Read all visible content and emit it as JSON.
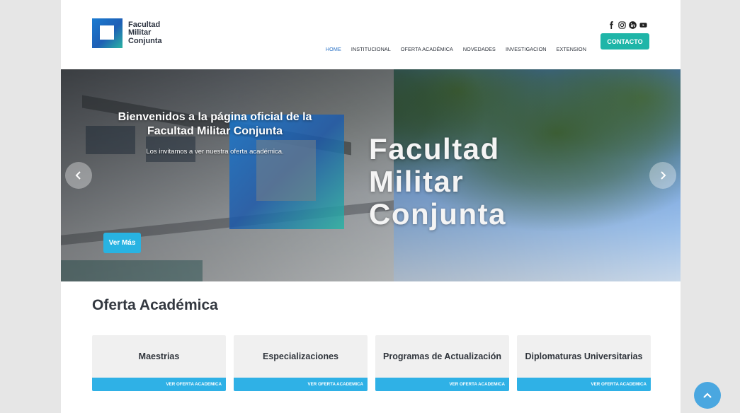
{
  "header": {
    "logo_text": [
      "Facultad",
      "Militar",
      "Conjunta"
    ],
    "social": [
      {
        "name": "facebook",
        "icon": "facebook-icon"
      },
      {
        "name": "instagram",
        "icon": "instagram-icon"
      },
      {
        "name": "linkedin",
        "icon": "linkedin-icon"
      },
      {
        "name": "youtube",
        "icon": "youtube-icon"
      }
    ],
    "contact_label": "CONTACTO",
    "nav": [
      {
        "label": "HOME",
        "active": true
      },
      {
        "label": "INSTITUCIONAL",
        "active": false
      },
      {
        "label": "OFERTA ACADÉMICA",
        "active": false
      },
      {
        "label": "NOVEDADES",
        "active": false
      },
      {
        "label": "INVESTIGACION",
        "active": false
      },
      {
        "label": "EXTENSION",
        "active": false
      }
    ]
  },
  "hero": {
    "title": "Bienvenidos a la página oficial de la Facultad Militar Conjunta",
    "subtitle": "Los invitamos a ver nuestra oferta académica.",
    "brand_lines": [
      "Facultad",
      "Militar",
      "Conjunta"
    ],
    "button_label": "Ver Más"
  },
  "oferta": {
    "title": "Oferta Académica",
    "cards": [
      {
        "title": "Maestrias",
        "link": "VER OFERTA ACADEMICA"
      },
      {
        "title": "Especializaciones",
        "link": "VER OFERTA ACADEMICA"
      },
      {
        "title": "Programas de Actualización",
        "link": "VER OFERTA ACADEMICA"
      },
      {
        "title": "Diplomaturas Universitarias",
        "link": "VER OFERTA ACADEMICA"
      }
    ]
  },
  "colors": {
    "accent_teal": "#1fb5a8",
    "accent_blue": "#2fb1e6",
    "nav_active": "#2a72c6"
  }
}
